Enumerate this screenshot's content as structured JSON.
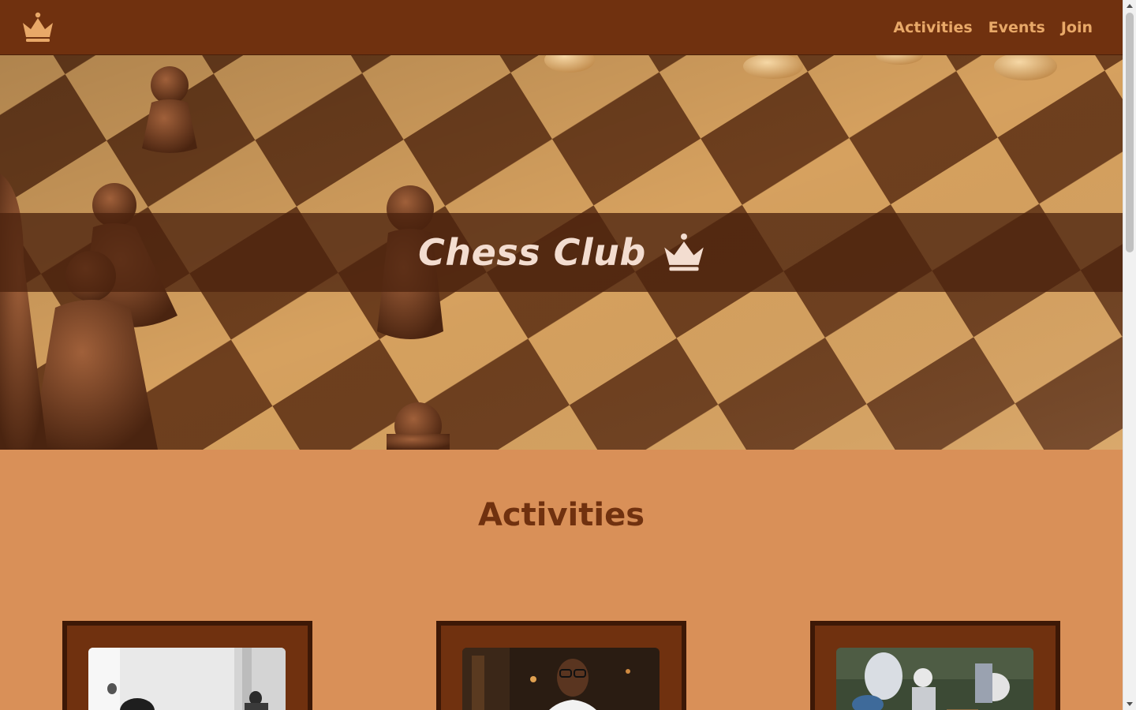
{
  "nav": {
    "logo_icon": "crown-icon",
    "links": [
      "Activities",
      "Events",
      "Join"
    ]
  },
  "hero": {
    "title": "Chess Club",
    "title_icon": "crown-icon"
  },
  "activities": {
    "heading": "Activities",
    "cards": [
      {
        "image": "people-playing-chess-bw-photo"
      },
      {
        "image": "man-with-glasses-playing-chess-photo"
      },
      {
        "image": "elderly-men-playing-chess-outdoors-photo"
      }
    ]
  },
  "colors": {
    "nav_bg": "#70310F",
    "nav_link": "#E8A868",
    "page_bg": "#D99058",
    "heading": "#70310F",
    "card_bg": "#70310F",
    "card_border": "#3D1806",
    "hero_title": "#F3DDD0"
  }
}
